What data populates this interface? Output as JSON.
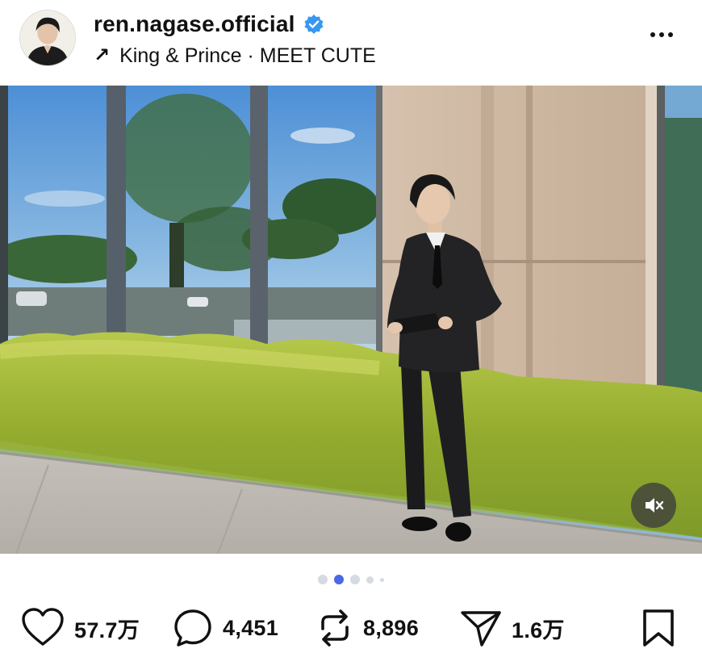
{
  "profile": {
    "username": "ren.nagase.official",
    "verified": true,
    "verified_color": "#3897f0"
  },
  "music": {
    "icon": "arrow-up-right-icon",
    "arrow": "↗",
    "text": "King & Prince · MEET CUTE"
  },
  "menu": {
    "icon": "more-dots-icon"
  },
  "media": {
    "description_icon": "photo",
    "mute_icon": "speaker-muted-icon"
  },
  "carousel": {
    "total_dots": 5,
    "active_index": 1,
    "accent_color": "#4a68e6"
  },
  "actions": {
    "likes": "57.7万",
    "comments": "4,451",
    "reposts": "8,896",
    "shares": "1.6万"
  }
}
